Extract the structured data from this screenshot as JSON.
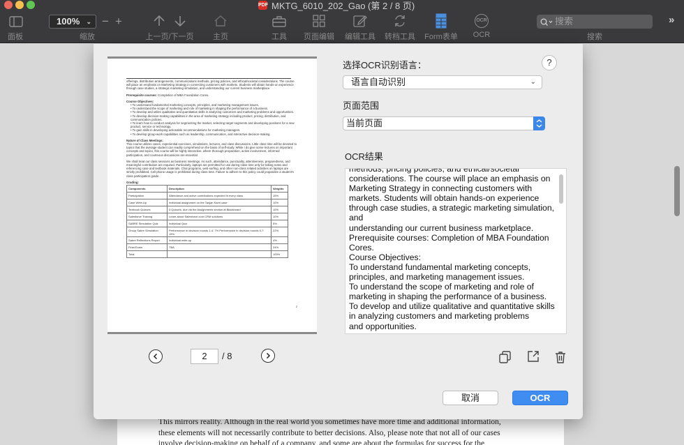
{
  "window": {
    "title": "MKTG_6010_202_Gao (第 2 / 8 页)",
    "pdf_badge": "PDF"
  },
  "toolbar": {
    "panel_label": "面板",
    "zoom_value": "100%",
    "zoom_caret": "⌄",
    "zoom_label": "缩放",
    "zoom_out": "−",
    "zoom_in": "+",
    "prevnext_label": "上一页/下一页",
    "home_label": "主页",
    "tools_label": "工具",
    "page_edit_label": "页面编辑",
    "edit_tools_label": "编辑工具",
    "convert_tools_label": "转档工具",
    "form_label": "Form表单",
    "ocr_label": "OCR",
    "ocr_icon_text": "OCR",
    "search_placeholder": "搜索",
    "search_label": "搜索",
    "more": "»"
  },
  "dialog": {
    "lang_title": "选择OCR识别语言：",
    "help": "?",
    "lang_value": "语言自动识别",
    "lang_caret": "⌄",
    "range_title": "页面范围",
    "range_value": "当前页面",
    "result_title": "OCR结果",
    "result_lines": [
      "methods, pricing policies, and ethical/societal",
      "considerations. The course will place an emphasis on",
      "Marketing Strategy in connecting customers with",
      "markets. Students will obtain hands-on experience",
      "through case studies, a strategic marketing simulation,",
      "and",
      "understanding our current business marketplace.",
      "Prerequisite courses: Completion of MBA Foundation",
      "Cores.",
      "Course Objectives:",
      "To understand fundamental marketing concepts,",
      "principles, and marketing management issues.",
      "To understand the scope of marketing and role of",
      "marketing in shaping the performance of a business.",
      "To develop and utilize qualitative and quantitative skills",
      "in analyzing customers and marketing problems",
      "and opportunities."
    ],
    "page_current": "2",
    "page_total": "/ 8",
    "cancel_label": "取消",
    "ocr_label": "OCR"
  },
  "preview": {
    "intro": "offerings, distribution arrangements, communications methods, pricing policies, and ethical/societal considerations. The course will place an emphasis on Marketing Strategy in connecting customers with markets. Students will obtain hands-on experience through case studies, a strategic marketing simulation, and understanding our current business marketplace.",
    "prereq_label": "Prerequisite courses:",
    "prereq_text": "Completion of MBA Foundation Cores.",
    "objectives_title": "Course Objectives:",
    "objectives": [
      "To understand fundamental marketing concepts, principles, and marketing management issues.",
      "To understand the scope of marketing and role of marketing in shaping the performance of a business.",
      "To develop and utilize qualitative and quantitative skills in analyzing customers and marketing problems and opportunities.",
      "To develop decision-making capabilities in the area of marketing strategy including product, pricing, distribution, and communication policies.",
      "To learn how to conduct analysis for segmenting the market, selecting target segments and developing positions for a new product, service or technology.",
      "To gain skills in developing actionable recommendations for marketing managers.",
      "To develop group-work capabilities such as leadership, communication, and interactive decision-making."
    ],
    "meetings_title": "Nature of Class Meetings:",
    "meetings_text": "This course utilizes cases, experiential exercises, simulations, lectures, and class discussions. Little class time will be devoted to topics that the average student can readily comprehend on the basis of self-study. While I do give some lectures on important concepts and topics, this course will be highly interactive, where thorough preparation, active involvement, informed participation, and courteous discussions are essential.",
    "treat_text": "We shall treat our class sessions as business meetings. As such, attendance, punctuality, attentiveness, preparedness, and meaningful contribution are required. Particularly, laptops are permitted for use during class time only for taking notes and referencing case and textbook materials. Chat programs, web-surfing, and other non-class related activities on laptops are strictly prohibited. Cell phone usage is prohibited during class time. Failure to adhere to this policy could jeopardize a student's class participation grade.",
    "grading_title": "Grading:",
    "table_headers": [
      "Components",
      "Description",
      "Weights"
    ],
    "table_rows": [
      [
        "Participation",
        "Attendance and active contributions expected in every class",
        "15%"
      ],
      [
        "Case Write-Up",
        "Individual assignment on the Tanjan Karni case",
        "10%"
      ],
      [
        "Textbook Quizzes",
        "3 Quizzes, due via the Assignments section at Blackboard",
        "10%"
      ],
      [
        "Salesforce Training",
        "Learn about Salesforce.com CRM solutions",
        "10%"
      ],
      [
        "SABRE Simulation Quiz",
        "Individual Quiz",
        "5%"
      ],
      [
        "Group Sabre Simulation",
        "Performance in decision rounds 1-4: 7%  Performance in decision rounds 5-7: 15%",
        "22%"
      ],
      [
        "Sabre Reflections Report",
        "Individual write-up",
        "4%"
      ],
      [
        "Final Exam",
        "TBA",
        "24%"
      ],
      [
        "Total",
        "",
        "100%"
      ]
    ],
    "page_number": "2"
  },
  "document": {
    "lines": [
      "This mirrors reality. Although in the real world you sometimes have more time and additional information,",
      "these elements will not necessarily contribute to better decisions. Also, please note that not all of our cases",
      "involve decision-making on behalf of a company, and some are about the formulas for success for the"
    ]
  },
  "colors": {
    "toolbar_bg": "#3a3a3c",
    "dialog_bg": "#ececec",
    "accent_blue": "#3f8df0"
  }
}
